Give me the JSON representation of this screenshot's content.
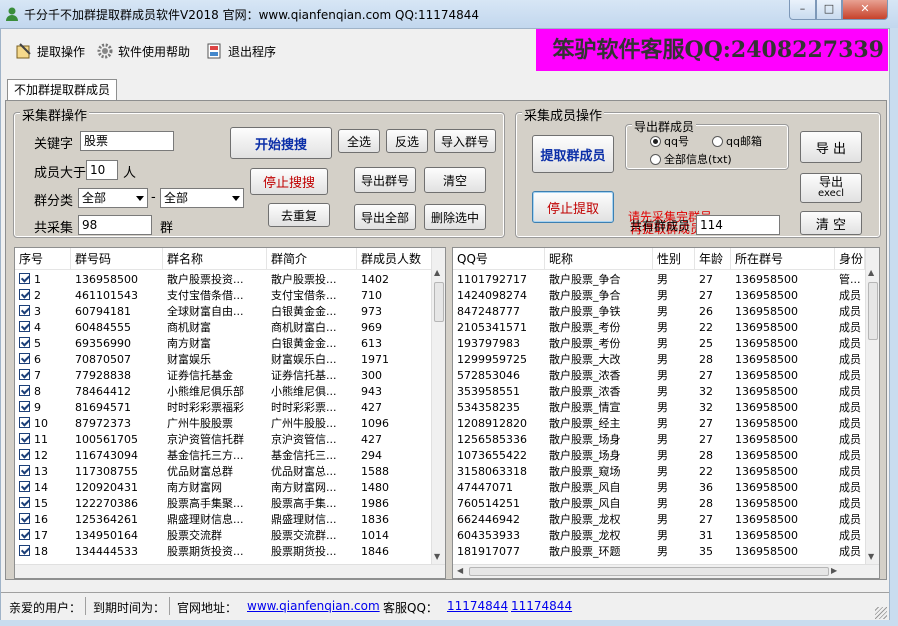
{
  "window": {
    "title": "千分千不加群提取群成员软件V2018 官网：www.qianfenqian.com QQ:11174844",
    "min": "–",
    "max": "□",
    "close": "✕"
  },
  "toolbar": {
    "extract": "提取操作",
    "help": "软件使用帮助",
    "exit": "退出程序",
    "banner": "笨驴软件客服QQ:2408227339"
  },
  "tab": "不加群提取群成员",
  "left_group": {
    "title": "采集群操作",
    "keyword_label": "关键字",
    "keyword_value": "股票",
    "members_label": "成员大于",
    "members_value": "10",
    "members_unit": "人",
    "category_label": "群分类",
    "category1": "全部",
    "dash": "-",
    "category2": "全部",
    "total_label": "共采集",
    "total_value": "98",
    "total_unit": "群",
    "start": "开始搜搜",
    "stop": "停止搜搜",
    "dedupe": "去重复",
    "select_all": "全选",
    "invert": "反选",
    "import": "导入群号",
    "export_ids": "导出群号",
    "clear": "清空",
    "export_all": "导出全部",
    "delete_selected": "删除选中"
  },
  "right_group": {
    "title": "采集成员操作",
    "extract": "提取群成员",
    "stop": "停止提取",
    "export_title": "导出群成员",
    "opt_qq": "qq号",
    "opt_mail": "qq邮箱",
    "opt_all": "全部信息(txt)",
    "export": "导 出",
    "export_excel1": "导出",
    "export_excel2": "execl",
    "clear": "清 空",
    "warn1": "请先采集完群号，",
    "warn2": "再提取群成员",
    "count_label": "共有群成员",
    "count_value": "114"
  },
  "group_table": {
    "headers": [
      "序号",
      "群号码",
      "群名称",
      "群简介",
      "群成员人数"
    ],
    "rows": [
      [
        "1",
        "136958500",
        "散户股票投资...",
        "散户股票投...",
        "1402"
      ],
      [
        "2",
        "461101543",
        "支付宝借条借...",
        "支付宝借条...",
        "710"
      ],
      [
        "3",
        "60794181",
        "全球财富自由...",
        "白银黄金金...",
        "973"
      ],
      [
        "4",
        "60484555",
        "商机财富",
        "商机财富白...",
        "969"
      ],
      [
        "5",
        "69356990",
        "南方财富",
        "白银黄金金...",
        "613"
      ],
      [
        "6",
        "70870507",
        "财富娱乐",
        "财富娱乐白...",
        "1971"
      ],
      [
        "7",
        "77928838",
        "证券信托基金",
        "证券信托基...",
        "300"
      ],
      [
        "8",
        "78464412",
        "小熊维尼俱乐部",
        "小熊维尼俱...",
        "943"
      ],
      [
        "9",
        "81694571",
        "时时彩彩票福彩",
        "时时彩彩票...",
        "427"
      ],
      [
        "10",
        "87972373",
        "广州牛股股票",
        "广州牛股股...",
        "1096"
      ],
      [
        "11",
        "100561705",
        "京沪资管信托群",
        "京沪资管信...",
        "427"
      ],
      [
        "12",
        "116743094",
        "基金信托三方...",
        "基金信托三...",
        "294"
      ],
      [
        "13",
        "117308755",
        "优品财富总群",
        "优品财富总...",
        "1588"
      ],
      [
        "14",
        "120920431",
        "南方财富网",
        "南方财富网...",
        "1480"
      ],
      [
        "15",
        "122270386",
        "股票高手集聚...",
        "股票高手集...",
        "1986"
      ],
      [
        "16",
        "125364261",
        "鼎盛理财信息...",
        "鼎盛理财信...",
        "1836"
      ],
      [
        "17",
        "134950164",
        "股票交流群",
        "股票交流群...",
        "1014"
      ],
      [
        "18",
        "134444533",
        "股票期货投资...",
        "股票期货投...",
        "1846"
      ]
    ]
  },
  "member_table": {
    "headers": [
      "QQ号",
      "昵称",
      "性别",
      "年龄",
      "所在群号",
      "身份"
    ],
    "rows": [
      [
        "1101792717",
        "散户股票_争合",
        "男",
        "27",
        "136958500",
        "管..."
      ],
      [
        "1424098274",
        "散户股票_争合",
        "男",
        "27",
        "136958500",
        "成员"
      ],
      [
        "847248777",
        "散户股票_争铁",
        "男",
        "26",
        "136958500",
        "成员"
      ],
      [
        "2105341571",
        "散户股票_考份",
        "男",
        "22",
        "136958500",
        "成员"
      ],
      [
        "193797983",
        "散户股票_考份",
        "男",
        "25",
        "136958500",
        "成员"
      ],
      [
        "1299959725",
        "散户股票_大改",
        "男",
        "28",
        "136958500",
        "成员"
      ],
      [
        "572853046",
        "散户股票_浓香",
        "男",
        "27",
        "136958500",
        "成员"
      ],
      [
        "353958551",
        "散户股票_浓香",
        "男",
        "32",
        "136958500",
        "成员"
      ],
      [
        "534358235",
        "散户股票_情宣",
        "男",
        "32",
        "136958500",
        "成员"
      ],
      [
        "1208912820",
        "散户股票_经主",
        "男",
        "27",
        "136958500",
        "成员"
      ],
      [
        "1256585336",
        "散户股票_场身",
        "男",
        "27",
        "136958500",
        "成员"
      ],
      [
        "1073655422",
        "散户股票_场身",
        "男",
        "28",
        "136958500",
        "成员"
      ],
      [
        "3158063318",
        "散户股票_窥场",
        "男",
        "22",
        "136958500",
        "成员"
      ],
      [
        "47447071",
        "散户股票_风自",
        "男",
        "36",
        "136958500",
        "成员"
      ],
      [
        "760514251",
        "散户股票_风自",
        "男",
        "28",
        "136958500",
        "成员"
      ],
      [
        "662446942",
        "散户股票_龙权",
        "男",
        "27",
        "136958500",
        "成员"
      ],
      [
        "604353933",
        "散户股票_龙权",
        "男",
        "31",
        "136958500",
        "成员"
      ],
      [
        "181917077",
        "散户股票_环题",
        "男",
        "35",
        "136958500",
        "成员"
      ]
    ]
  },
  "status": {
    "user": "亲爱的用户：",
    "expire": "到期时间为：",
    "site_label": "官网地址：",
    "site": "www.qianfenqian.com",
    "qq_label": "客服QQ：",
    "qq1": "11174844",
    "qq2": "11174844"
  },
  "colors": {
    "banner_bg": "#ff00ff",
    "link": "#0000ee",
    "warn": "#e00000",
    "primary_text": "#0b2fa8",
    "stop_text": "#c00000"
  },
  "icons": [
    "app-icon",
    "extract-icon",
    "gear-icon",
    "exit-icon"
  ]
}
